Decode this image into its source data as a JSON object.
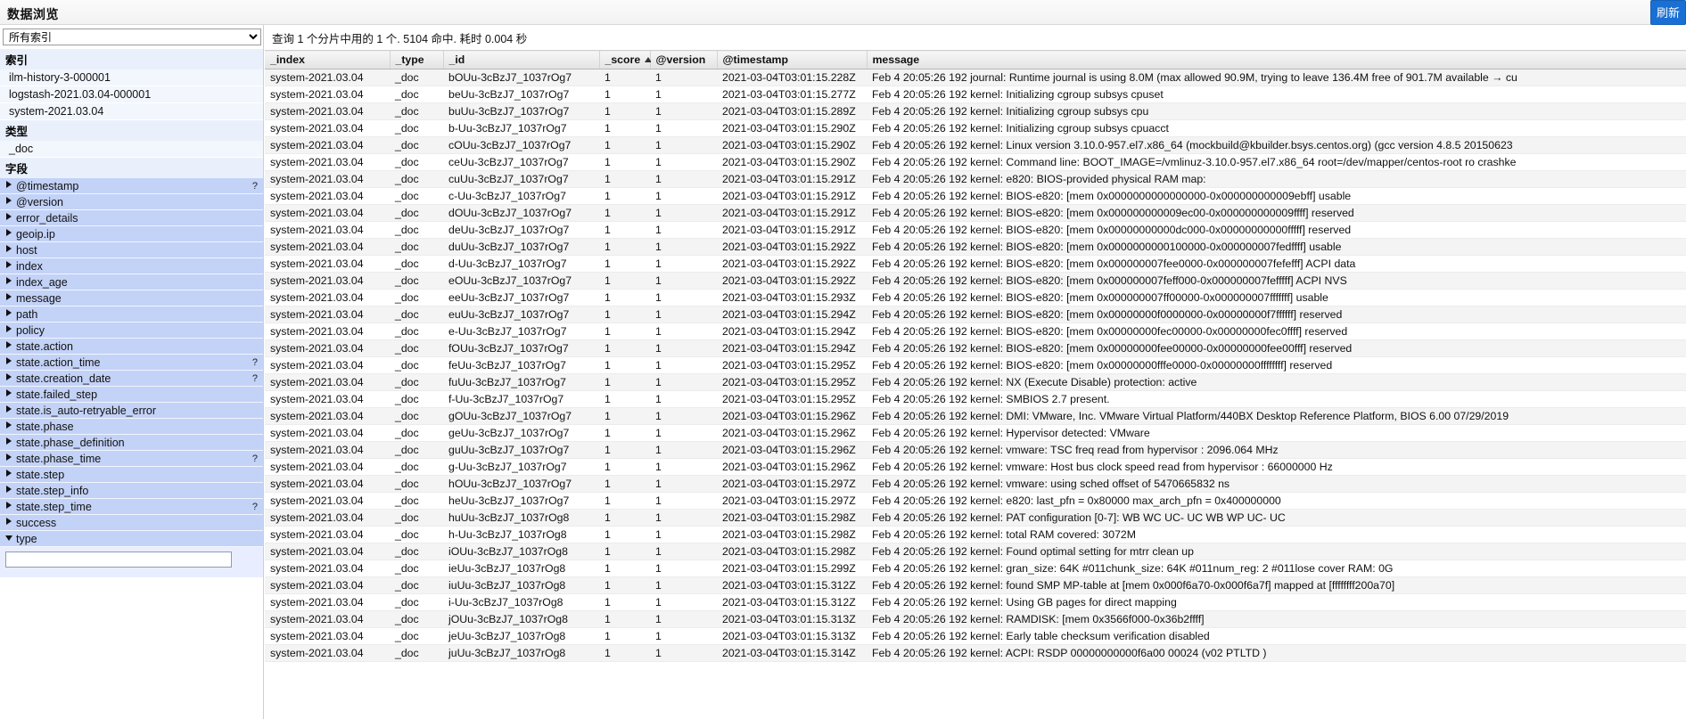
{
  "app": {
    "title": "数据浏览",
    "top_right_button": "刷新"
  },
  "sidebar": {
    "index_select": {
      "value": "所有索引",
      "options": [
        "所有索引",
        "ilm-history-3-000001",
        "logstash-2021.03.04-000001",
        "system-2021.03.04"
      ]
    },
    "sections": [
      {
        "heading": "索引",
        "items": [
          "ilm-history-3-000001",
          "logstash-2021.03.04-000001",
          "system-2021.03.04"
        ]
      },
      {
        "heading": "类型",
        "items": [
          "_doc"
        ]
      }
    ],
    "fields_heading": "字段",
    "fields": [
      {
        "label": "@timestamp",
        "has_info": true,
        "expanded": false
      },
      {
        "label": "@version",
        "has_info": false,
        "expanded": false
      },
      {
        "label": "error_details",
        "has_info": false,
        "expanded": false
      },
      {
        "label": "geoip.ip",
        "has_info": false,
        "expanded": false
      },
      {
        "label": "host",
        "has_info": false,
        "expanded": false
      },
      {
        "label": "index",
        "has_info": false,
        "expanded": false
      },
      {
        "label": "index_age",
        "has_info": false,
        "expanded": false
      },
      {
        "label": "message",
        "has_info": false,
        "expanded": false
      },
      {
        "label": "path",
        "has_info": false,
        "expanded": false
      },
      {
        "label": "policy",
        "has_info": false,
        "expanded": false
      },
      {
        "label": "state.action",
        "has_info": false,
        "expanded": false
      },
      {
        "label": "state.action_time",
        "has_info": true,
        "expanded": false
      },
      {
        "label": "state.creation_date",
        "has_info": true,
        "expanded": false
      },
      {
        "label": "state.failed_step",
        "has_info": false,
        "expanded": false
      },
      {
        "label": "state.is_auto-retryable_error",
        "has_info": false,
        "expanded": false
      },
      {
        "label": "state.phase",
        "has_info": false,
        "expanded": false
      },
      {
        "label": "state.phase_definition",
        "has_info": false,
        "expanded": false
      },
      {
        "label": "state.phase_time",
        "has_info": true,
        "expanded": false
      },
      {
        "label": "state.step",
        "has_info": false,
        "expanded": false
      },
      {
        "label": "state.step_info",
        "has_info": false,
        "expanded": false
      },
      {
        "label": "state.step_time",
        "has_info": true,
        "expanded": false
      },
      {
        "label": "success",
        "has_info": false,
        "expanded": false
      },
      {
        "label": "type",
        "has_info": false,
        "expanded": true
      }
    ],
    "filter_input": {
      "value": "",
      "placeholder": ""
    }
  },
  "main": {
    "query_info": "查询 1 个分片中用的 1 个. 5104 命中. 耗时 0.004 秒",
    "columns": [
      {
        "key": "_index",
        "label": "_index",
        "sorted": false
      },
      {
        "key": "_type",
        "label": "_type",
        "sorted": false
      },
      {
        "key": "_id",
        "label": "_id",
        "sorted": false
      },
      {
        "key": "_score",
        "label": "_score",
        "sorted": true,
        "sort_dir": "asc"
      },
      {
        "key": "@version",
        "label": "@version",
        "sorted": false
      },
      {
        "key": "@timestamp",
        "label": "@timestamp",
        "sorted": false
      },
      {
        "key": "message",
        "label": "message",
        "sorted": false
      }
    ],
    "rows": [
      {
        "_index": "system-2021.03.04",
        "_type": "_doc",
        "_id": "bOUu-3cBzJ7_1037rOg7",
        "_score": "1",
        "@version": "1",
        "@timestamp": "2021-03-04T03:01:15.228Z",
        "message": "Feb 4 20:05:26 192 journal: Runtime journal is using 8.0M (max allowed 90.9M, trying to leave 136.4M free of 901.7M available → cu"
      },
      {
        "_index": "system-2021.03.04",
        "_type": "_doc",
        "_id": "beUu-3cBzJ7_1037rOg7",
        "_score": "1",
        "@version": "1",
        "@timestamp": "2021-03-04T03:01:15.277Z",
        "message": "Feb 4 20:05:26 192 kernel: Initializing cgroup subsys cpuset"
      },
      {
        "_index": "system-2021.03.04",
        "_type": "_doc",
        "_id": "buUu-3cBzJ7_1037rOg7",
        "_score": "1",
        "@version": "1",
        "@timestamp": "2021-03-04T03:01:15.289Z",
        "message": "Feb 4 20:05:26 192 kernel: Initializing cgroup subsys cpu"
      },
      {
        "_index": "system-2021.03.04",
        "_type": "_doc",
        "_id": "b-Uu-3cBzJ7_1037rOg7",
        "_score": "1",
        "@version": "1",
        "@timestamp": "2021-03-04T03:01:15.290Z",
        "message": "Feb 4 20:05:26 192 kernel: Initializing cgroup subsys cpuacct"
      },
      {
        "_index": "system-2021.03.04",
        "_type": "_doc",
        "_id": "cOUu-3cBzJ7_1037rOg7",
        "_score": "1",
        "@version": "1",
        "@timestamp": "2021-03-04T03:01:15.290Z",
        "message": "Feb 4 20:05:26 192 kernel: Linux version 3.10.0-957.el7.x86_64 (mockbuild@kbuilder.bsys.centos.org) (gcc version 4.8.5 20150623"
      },
      {
        "_index": "system-2021.03.04",
        "_type": "_doc",
        "_id": "ceUu-3cBzJ7_1037rOg7",
        "_score": "1",
        "@version": "1",
        "@timestamp": "2021-03-04T03:01:15.290Z",
        "message": "Feb 4 20:05:26 192 kernel: Command line: BOOT_IMAGE=/vmlinuz-3.10.0-957.el7.x86_64 root=/dev/mapper/centos-root ro crashke"
      },
      {
        "_index": "system-2021.03.04",
        "_type": "_doc",
        "_id": "cuUu-3cBzJ7_1037rOg7",
        "_score": "1",
        "@version": "1",
        "@timestamp": "2021-03-04T03:01:15.291Z",
        "message": "Feb 4 20:05:26 192 kernel: e820: BIOS-provided physical RAM map:"
      },
      {
        "_index": "system-2021.03.04",
        "_type": "_doc",
        "_id": "c-Uu-3cBzJ7_1037rOg7",
        "_score": "1",
        "@version": "1",
        "@timestamp": "2021-03-04T03:01:15.291Z",
        "message": "Feb 4 20:05:26 192 kernel: BIOS-e820: [mem 0x0000000000000000-0x000000000009ebff] usable"
      },
      {
        "_index": "system-2021.03.04",
        "_type": "_doc",
        "_id": "dOUu-3cBzJ7_1037rOg7",
        "_score": "1",
        "@version": "1",
        "@timestamp": "2021-03-04T03:01:15.291Z",
        "message": "Feb 4 20:05:26 192 kernel: BIOS-e820: [mem 0x000000000009ec00-0x000000000009ffff] reserved"
      },
      {
        "_index": "system-2021.03.04",
        "_type": "_doc",
        "_id": "deUu-3cBzJ7_1037rOg7",
        "_score": "1",
        "@version": "1",
        "@timestamp": "2021-03-04T03:01:15.291Z",
        "message": "Feb 4 20:05:26 192 kernel: BIOS-e820: [mem 0x00000000000dc000-0x00000000000fffff] reserved"
      },
      {
        "_index": "system-2021.03.04",
        "_type": "_doc",
        "_id": "duUu-3cBzJ7_1037rOg7",
        "_score": "1",
        "@version": "1",
        "@timestamp": "2021-03-04T03:01:15.292Z",
        "message": "Feb 4 20:05:26 192 kernel: BIOS-e820: [mem 0x0000000000100000-0x000000007fedffff] usable"
      },
      {
        "_index": "system-2021.03.04",
        "_type": "_doc",
        "_id": "d-Uu-3cBzJ7_1037rOg7",
        "_score": "1",
        "@version": "1",
        "@timestamp": "2021-03-04T03:01:15.292Z",
        "message": "Feb 4 20:05:26 192 kernel: BIOS-e820: [mem 0x000000007fee0000-0x000000007fefefff] ACPI data"
      },
      {
        "_index": "system-2021.03.04",
        "_type": "_doc",
        "_id": "eOUu-3cBzJ7_1037rOg7",
        "_score": "1",
        "@version": "1",
        "@timestamp": "2021-03-04T03:01:15.292Z",
        "message": "Feb 4 20:05:26 192 kernel: BIOS-e820: [mem 0x000000007feff000-0x000000007fefffff] ACPI NVS"
      },
      {
        "_index": "system-2021.03.04",
        "_type": "_doc",
        "_id": "eeUu-3cBzJ7_1037rOg7",
        "_score": "1",
        "@version": "1",
        "@timestamp": "2021-03-04T03:01:15.293Z",
        "message": "Feb 4 20:05:26 192 kernel: BIOS-e820: [mem 0x000000007ff00000-0x000000007fffffff] usable"
      },
      {
        "_index": "system-2021.03.04",
        "_type": "_doc",
        "_id": "euUu-3cBzJ7_1037rOg7",
        "_score": "1",
        "@version": "1",
        "@timestamp": "2021-03-04T03:01:15.294Z",
        "message": "Feb 4 20:05:26 192 kernel: BIOS-e820: [mem 0x00000000f0000000-0x00000000f7ffffff] reserved"
      },
      {
        "_index": "system-2021.03.04",
        "_type": "_doc",
        "_id": "e-Uu-3cBzJ7_1037rOg7",
        "_score": "1",
        "@version": "1",
        "@timestamp": "2021-03-04T03:01:15.294Z",
        "message": "Feb 4 20:05:26 192 kernel: BIOS-e820: [mem 0x00000000fec00000-0x00000000fec0ffff] reserved"
      },
      {
        "_index": "system-2021.03.04",
        "_type": "_doc",
        "_id": "fOUu-3cBzJ7_1037rOg7",
        "_score": "1",
        "@version": "1",
        "@timestamp": "2021-03-04T03:01:15.294Z",
        "message": "Feb 4 20:05:26 192 kernel: BIOS-e820: [mem 0x00000000fee00000-0x00000000fee00fff] reserved"
      },
      {
        "_index": "system-2021.03.04",
        "_type": "_doc",
        "_id": "feUu-3cBzJ7_1037rOg7",
        "_score": "1",
        "@version": "1",
        "@timestamp": "2021-03-04T03:01:15.295Z",
        "message": "Feb 4 20:05:26 192 kernel: BIOS-e820: [mem 0x00000000fffe0000-0x00000000ffffffff] reserved"
      },
      {
        "_index": "system-2021.03.04",
        "_type": "_doc",
        "_id": "fuUu-3cBzJ7_1037rOg7",
        "_score": "1",
        "@version": "1",
        "@timestamp": "2021-03-04T03:01:15.295Z",
        "message": "Feb 4 20:05:26 192 kernel: NX (Execute Disable) protection: active"
      },
      {
        "_index": "system-2021.03.04",
        "_type": "_doc",
        "_id": "f-Uu-3cBzJ7_1037rOg7",
        "_score": "1",
        "@version": "1",
        "@timestamp": "2021-03-04T03:01:15.295Z",
        "message": "Feb 4 20:05:26 192 kernel: SMBIOS 2.7 present."
      },
      {
        "_index": "system-2021.03.04",
        "_type": "_doc",
        "_id": "gOUu-3cBzJ7_1037rOg7",
        "_score": "1",
        "@version": "1",
        "@timestamp": "2021-03-04T03:01:15.296Z",
        "message": "Feb 4 20:05:26 192 kernel: DMI: VMware, Inc. VMware Virtual Platform/440BX Desktop Reference Platform, BIOS 6.00 07/29/2019"
      },
      {
        "_index": "system-2021.03.04",
        "_type": "_doc",
        "_id": "geUu-3cBzJ7_1037rOg7",
        "_score": "1",
        "@version": "1",
        "@timestamp": "2021-03-04T03:01:15.296Z",
        "message": "Feb 4 20:05:26 192 kernel: Hypervisor detected: VMware"
      },
      {
        "_index": "system-2021.03.04",
        "_type": "_doc",
        "_id": "guUu-3cBzJ7_1037rOg7",
        "_score": "1",
        "@version": "1",
        "@timestamp": "2021-03-04T03:01:15.296Z",
        "message": "Feb 4 20:05:26 192 kernel: vmware: TSC freq read from hypervisor : 2096.064 MHz"
      },
      {
        "_index": "system-2021.03.04",
        "_type": "_doc",
        "_id": "g-Uu-3cBzJ7_1037rOg7",
        "_score": "1",
        "@version": "1",
        "@timestamp": "2021-03-04T03:01:15.296Z",
        "message": "Feb 4 20:05:26 192 kernel: vmware: Host bus clock speed read from hypervisor : 66000000 Hz"
      },
      {
        "_index": "system-2021.03.04",
        "_type": "_doc",
        "_id": "hOUu-3cBzJ7_1037rOg7",
        "_score": "1",
        "@version": "1",
        "@timestamp": "2021-03-04T03:01:15.297Z",
        "message": "Feb 4 20:05:26 192 kernel: vmware: using sched offset of 5470665832 ns"
      },
      {
        "_index": "system-2021.03.04",
        "_type": "_doc",
        "_id": "heUu-3cBzJ7_1037rOg7",
        "_score": "1",
        "@version": "1",
        "@timestamp": "2021-03-04T03:01:15.297Z",
        "message": "Feb 4 20:05:26 192 kernel: e820: last_pfn = 0x80000 max_arch_pfn = 0x400000000"
      },
      {
        "_index": "system-2021.03.04",
        "_type": "_doc",
        "_id": "huUu-3cBzJ7_1037rOg8",
        "_score": "1",
        "@version": "1",
        "@timestamp": "2021-03-04T03:01:15.298Z",
        "message": "Feb 4 20:05:26 192 kernel: PAT configuration [0-7]: WB WC UC- UC WB WP UC- UC"
      },
      {
        "_index": "system-2021.03.04",
        "_type": "_doc",
        "_id": "h-Uu-3cBzJ7_1037rOg8",
        "_score": "1",
        "@version": "1",
        "@timestamp": "2021-03-04T03:01:15.298Z",
        "message": "Feb 4 20:05:26 192 kernel: total RAM covered: 3072M"
      },
      {
        "_index": "system-2021.03.04",
        "_type": "_doc",
        "_id": "iOUu-3cBzJ7_1037rOg8",
        "_score": "1",
        "@version": "1",
        "@timestamp": "2021-03-04T03:01:15.298Z",
        "message": "Feb 4 20:05:26 192 kernel: Found optimal setting for mtrr clean up"
      },
      {
        "_index": "system-2021.03.04",
        "_type": "_doc",
        "_id": "ieUu-3cBzJ7_1037rOg8",
        "_score": "1",
        "@version": "1",
        "@timestamp": "2021-03-04T03:01:15.299Z",
        "message": "Feb 4 20:05:26 192 kernel: gran_size: 64K #011chunk_size: 64K #011num_reg: 2 #011lose cover RAM: 0G"
      },
      {
        "_index": "system-2021.03.04",
        "_type": "_doc",
        "_id": "iuUu-3cBzJ7_1037rOg8",
        "_score": "1",
        "@version": "1",
        "@timestamp": "2021-03-04T03:01:15.312Z",
        "message": "Feb 4 20:05:26 192 kernel: found SMP MP-table at [mem 0x000f6a70-0x000f6a7f] mapped at [ffffffff200a70]"
      },
      {
        "_index": "system-2021.03.04",
        "_type": "_doc",
        "_id": "i-Uu-3cBzJ7_1037rOg8",
        "_score": "1",
        "@version": "1",
        "@timestamp": "2021-03-04T03:01:15.312Z",
        "message": "Feb 4 20:05:26 192 kernel: Using GB pages for direct mapping"
      },
      {
        "_index": "system-2021.03.04",
        "_type": "_doc",
        "_id": "jOUu-3cBzJ7_1037rOg8",
        "_score": "1",
        "@version": "1",
        "@timestamp": "2021-03-04T03:01:15.313Z",
        "message": "Feb 4 20:05:26 192 kernel: RAMDISK: [mem 0x3566f000-0x36b2ffff]"
      },
      {
        "_index": "system-2021.03.04",
        "_type": "_doc",
        "_id": "jeUu-3cBzJ7_1037rOg8",
        "_score": "1",
        "@version": "1",
        "@timestamp": "2021-03-04T03:01:15.313Z",
        "message": "Feb 4 20:05:26 192 kernel: Early table checksum verification disabled"
      },
      {
        "_index": "system-2021.03.04",
        "_type": "_doc",
        "_id": "juUu-3cBzJ7_1037rOg8",
        "_score": "1",
        "@version": "1",
        "@timestamp": "2021-03-04T03:01:15.314Z",
        "message": "Feb 4 20:05:26 192 kernel: ACPI: RSDP 00000000000f6a00 00024 (v02 PTLTD )"
      }
    ]
  },
  "colors": {
    "accent": "#1a6fd4",
    "field_row_bg": "#c3d2f7",
    "list_row_bg": "#f2f6fd",
    "header_bg": "#e3e3e3"
  }
}
